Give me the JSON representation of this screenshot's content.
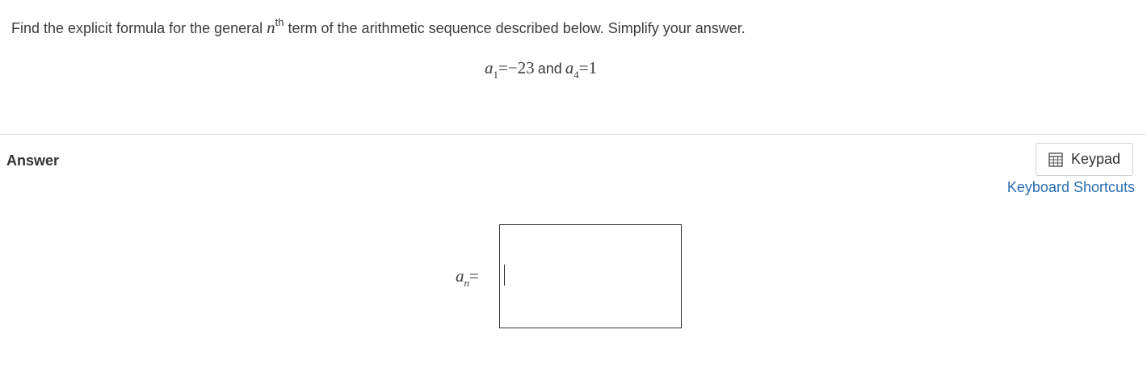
{
  "question": {
    "text_before": "Find the explicit formula for the general ",
    "var_n": "n",
    "sup_th": "th",
    "text_after": " term of the arithmetic sequence described below. Simplify your answer."
  },
  "equation": {
    "a1_var": "a",
    "a1_sub": "1",
    "eq1": "=",
    "a1_value": "−23",
    "and_text": "and",
    "a4_var": "a",
    "a4_sub": "4",
    "eq2": "=",
    "a4_value": "1"
  },
  "answer": {
    "heading": "Answer",
    "label_var": "a",
    "label_sub": "n",
    "label_eq": "=",
    "input_value": ""
  },
  "toolbar": {
    "keypad_label": "Keypad",
    "keypad_icon": "calculator-icon",
    "shortcuts_label": "Keyboard Shortcuts"
  },
  "colors": {
    "link": "#2a6eb0",
    "text": "#333333",
    "divider": "#dddddd"
  }
}
